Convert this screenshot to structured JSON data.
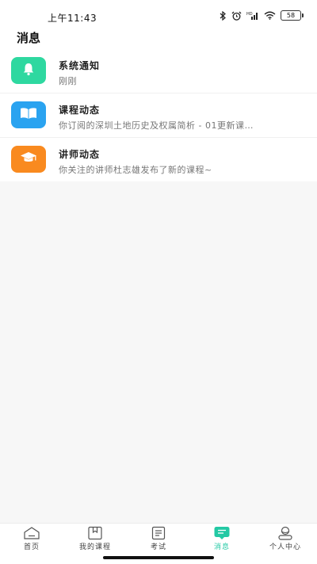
{
  "status_bar": {
    "time": "上午11:43",
    "battery": "58"
  },
  "header": {
    "title": "消息"
  },
  "messages": [
    {
      "title": "系统通知",
      "subtitle": "刚刚",
      "icon": "bell-icon",
      "color": "#2ed8a0"
    },
    {
      "title": "课程动态",
      "subtitle": "你订阅的深圳土地历史及权属简析 - 01更新课…",
      "icon": "book-icon",
      "color": "#2aa3f0"
    },
    {
      "title": "讲师动态",
      "subtitle": "你关注的讲师杜志雄发布了新的课程~",
      "icon": "graduation-cap-icon",
      "color": "#f98a1f"
    }
  ],
  "tabs": [
    {
      "label": "首页",
      "icon": "home-icon",
      "active": false
    },
    {
      "label": "我的课程",
      "icon": "bookmark-icon",
      "active": false
    },
    {
      "label": "考试",
      "icon": "document-icon",
      "active": false
    },
    {
      "label": "消息",
      "icon": "message-icon",
      "active": true
    },
    {
      "label": "个人中心",
      "icon": "user-icon",
      "active": false
    }
  ],
  "colors": {
    "accent": "#23c9a4",
    "background": "#f7f7f7"
  }
}
